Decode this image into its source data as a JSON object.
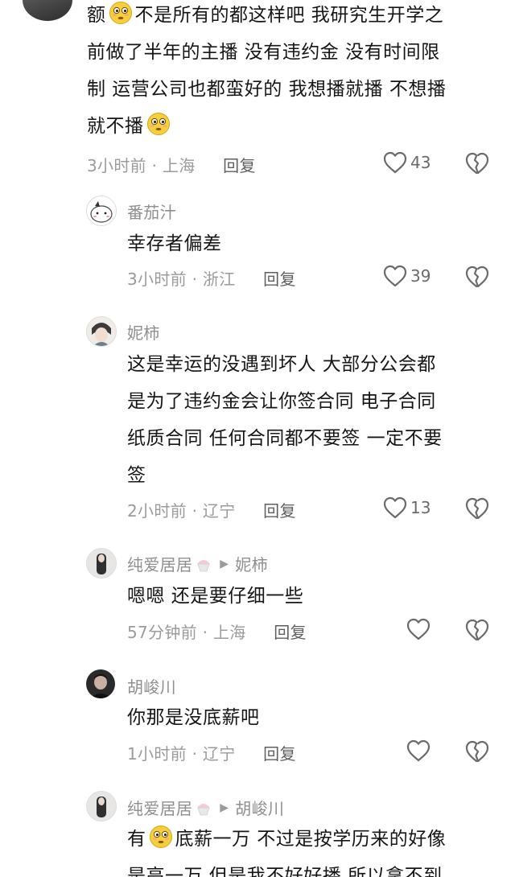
{
  "comments": [
    {
      "id": "c0",
      "lines": [
        "额",
        "不是所有的都这样吧 我研究生开学之",
        "前做了半年的主播 没有违约金 没有时间限",
        "制 运营公司也都蛮好的 我想播就播 不想播",
        "就不播"
      ],
      "time": "3小时前 · 上海",
      "reply": "回复",
      "likes": "43"
    },
    {
      "id": "c1",
      "user": "番茄汁",
      "lines": [
        "幸存者偏差"
      ],
      "time": "3小时前 · 浙江",
      "reply": "回复",
      "likes": "39"
    },
    {
      "id": "c2",
      "user": "妮柿",
      "lines": [
        "这是幸运的没遇到坏人 大部分公会都",
        "是为了违约金会让你签合同 电子合同",
        "纸质合同 任何合同都不要签 一定不要",
        "签"
      ],
      "time": "2小时前 · 辽宁",
      "reply": "回复",
      "likes": "13"
    },
    {
      "id": "c3",
      "user": "纯爱居居",
      "reply_to": "妮柿",
      "lines": [
        "嗯嗯 还是要仔细一些"
      ],
      "time": "57分钟前 · 上海",
      "reply": "回复",
      "likes": ""
    },
    {
      "id": "c4",
      "user": "胡峻川",
      "lines": [
        "你那是没底薪吧"
      ],
      "time": "1小时前 · 辽宁",
      "reply": "回复",
      "likes": ""
    },
    {
      "id": "c5",
      "user": "纯爱居居",
      "reply_to": "胡峻川",
      "lines": [
        "有",
        "底薪一万 不过是按学历来的好像",
        "是高一万 但是我不好好播 所以拿不到"
      ]
    }
  ],
  "icons": {
    "like": "heart-outline-icon",
    "dislike": "broken-heart-icon",
    "emoji": "flushed-emoji-icon"
  },
  "colors": {
    "text": "#161616",
    "meta": "#9b9b9b",
    "reply": "#5f5f5f",
    "name": "#8f8f8f"
  }
}
